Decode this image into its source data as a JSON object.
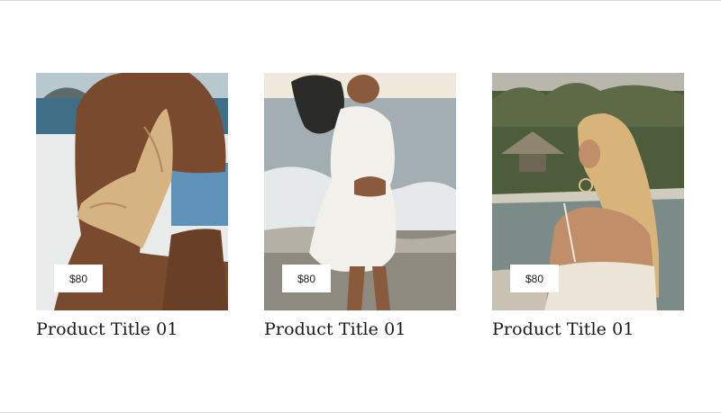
{
  "products": [
    {
      "title": "Product Title 01",
      "price": "$80",
      "image": "woman-in-swimsuit-sitting-by-sea",
      "palette": {
        "sky": "#c9d4d8",
        "sea": "#3d6f8a",
        "wall": "#e9ecea",
        "skin": "#7a4a2e",
        "suit": "#d8b98a",
        "accent": "#5b8fb6"
      }
    },
    {
      "title": "Product Title 01",
      "price": "$80",
      "image": "woman-in-white-dress-on-beach",
      "palette": {
        "sky": "#ece6da",
        "sea": "#9aa7ae",
        "wall": "#e3ddd2",
        "skin": "#8a5a3c",
        "suit": "#f3f1ec",
        "accent": "#c9c2b6"
      }
    },
    {
      "title": "Product Title 01",
      "price": "$80",
      "image": "woman-by-infinity-pool",
      "palette": {
        "sky": "#b9b8ad",
        "sea": "#7c8f8a",
        "wall": "#4f5e3d",
        "skin": "#c08f6a",
        "suit": "#ece4d6",
        "accent": "#d8b47a"
      }
    }
  ]
}
